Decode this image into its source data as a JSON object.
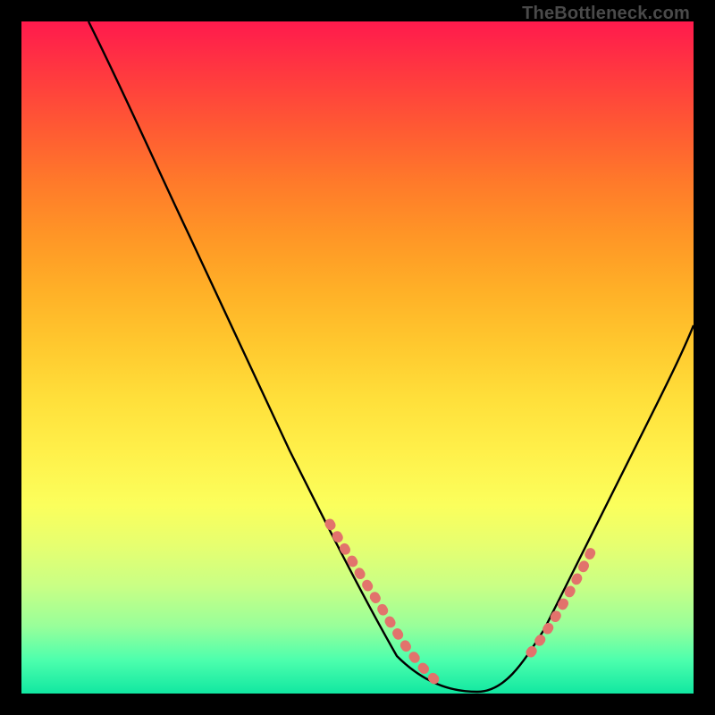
{
  "watermark": "TheBottleneck.com",
  "chart_data": {
    "type": "line",
    "title": "",
    "xlabel": "",
    "ylabel": "",
    "xlim": [
      0,
      100
    ],
    "ylim": [
      0,
      100
    ],
    "grid": false,
    "legend": false,
    "series": [
      {
        "name": "bottleneck-curve",
        "color": "#000000",
        "x": [
          10,
          15,
          20,
          25,
          30,
          35,
          40,
          45,
          48,
          50,
          52,
          54,
          56,
          58,
          60,
          62,
          65,
          70,
          75,
          80,
          85,
          90,
          95,
          100
        ],
        "y": [
          100,
          90,
          80,
          70,
          60,
          51,
          42,
          33,
          27,
          22,
          17,
          12,
          8,
          4,
          2,
          1,
          0,
          0,
          3,
          9,
          18,
          28,
          38,
          48
        ]
      },
      {
        "name": "highlight-left-segment",
        "color": "#e2736c",
        "style": "dotted",
        "x": [
          48,
          50,
          52,
          54,
          56,
          58,
          60,
          62
        ],
        "y": [
          27,
          22,
          17,
          12,
          8,
          4,
          2,
          1
        ]
      },
      {
        "name": "highlight-right-segment",
        "color": "#e2736c",
        "style": "dotted",
        "x": [
          78,
          80,
          82,
          84,
          86
        ],
        "y": [
          8,
          10,
          13,
          16,
          20
        ]
      }
    ],
    "background_gradient": {
      "top": "#ff1a4d",
      "mid": "#ffe640",
      "bottom": "#11e7a1"
    }
  }
}
